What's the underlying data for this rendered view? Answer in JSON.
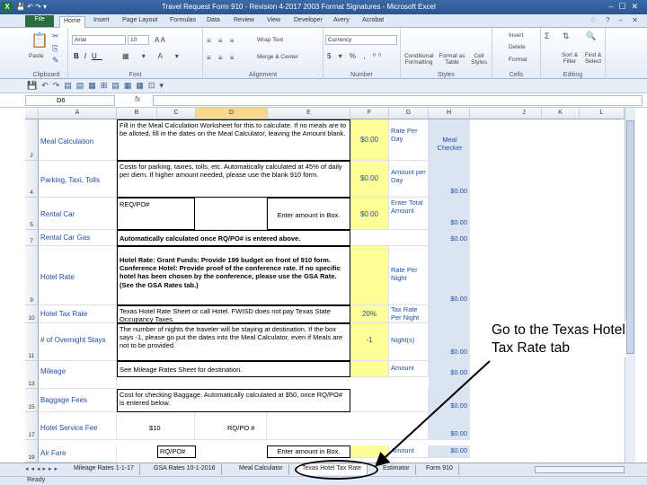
{
  "window": {
    "app_icon": "X",
    "title": "Travel Request Form 910 - Revision 4-2017 2003 Format Signatures - Microsoft Excel"
  },
  "ribbon_tabs": [
    "File",
    "Home",
    "Insert",
    "Page Layout",
    "Formulas",
    "Data",
    "Review",
    "View",
    "Developer",
    "Avery",
    "Acrobat"
  ],
  "ribbon": {
    "clipboard": {
      "paste": "Paste",
      "label": "Clipboard"
    },
    "font": {
      "name": "Arial",
      "size": "10",
      "label": "Font"
    },
    "alignment": {
      "wrap": "Wrap Text",
      "merge": "Merge & Center",
      "label": "Alignment"
    },
    "number": {
      "format": "Currency",
      "label": "Number"
    },
    "styles": {
      "conditional": "Conditional Formatting",
      "format_table": "Format as Table",
      "cell_styles": "Cell Styles",
      "label": "Styles"
    },
    "cells": {
      "insert": "Insert",
      "delete": "Delete",
      "format": "Format",
      "label": "Cells"
    },
    "editing": {
      "sort": "Sort & Filter",
      "find": "Find & Select",
      "label": "Editing"
    }
  },
  "formula_bar": {
    "name_box": "D6",
    "fx": "fx",
    "value": ""
  },
  "columns": [
    "A",
    "B",
    "C",
    "D",
    "E",
    "F",
    "G",
    "H",
    "I",
    "J",
    "K",
    "L"
  ],
  "sheet": {
    "rows": [
      {
        "row": "2",
        "label": "Meal Calculation",
        "instr": "Fill in the Meal Calculation Worksheet for this to calculate.  If no meals are to be alloted, fill in the dates on the Meal Calculator, leaving the Amount blank.",
        "amount": "$0.00",
        "g": "Rate Per Day",
        "h": "Meal Checker"
      },
      {
        "row": "4",
        "label": "Parking, Taxi, Tolls",
        "instr": "Costs for parking, taxies, tolls, etc.  Automatically calculated at 45% of daily per diem. If higher amount needed, please use the blank 910 form.",
        "amount": "$0.00",
        "g": "Amount per Day",
        "h": "$0.00"
      },
      {
        "row": "5",
        "label": "Rental Car",
        "b": "REQ/PO#",
        "e": "Enter amount in Box.",
        "amount": "$0.00",
        "g": "Enter Total Amount",
        "h": "$0.00"
      },
      {
        "row": "7",
        "label": "Rental Car Gas",
        "instr": "Automatically calculated  once RQ/PO# is entered above.",
        "h": "$0.00"
      },
      {
        "row": "9",
        "label": "Hotel Rate",
        "instr": "Hotel Rate: Grant Funds: Provide 199 budget on front of 910 form. Conference Hotel: Provide proof of the conference rate. If no specific hotel has been chosen by the conference, please use the GSA Rate. (See the GSA Rates tab.)",
        "g": "Rate Per Night",
        "h": "$0.00"
      },
      {
        "row": "10",
        "label": "Hotel Tax Rate",
        "instr": "Texas Hotel Rate Sheet or call Hotel.  FWISD does not pay Texas State Occupancy Taxes.",
        "amount": "20%",
        "g": "Tax Rate Per Night"
      },
      {
        "row": "11",
        "label": "# of Overnight Stays",
        "instr": "The number of nights the traveler will be staying at destination. If the box says -1, please go put the dates into the Meal Calculator, even if Meals are not to be provided.",
        "amount": "-1",
        "g": "Night(s)",
        "h": "$0.00"
      },
      {
        "row": "13",
        "label": "Mileage",
        "desc": "See Mileage Rates Sheet for destination.",
        "g": "Amount",
        "h": "$0.00"
      },
      {
        "row": "15",
        "label": "Baggage Fees",
        "instr": "Cost for checking Baggage. Automatically calculated at $50, once RQ/PO# is entered below.",
        "h": "$0.00"
      },
      {
        "row": "17",
        "label": "Hotel Service Fee",
        "b": "$10",
        "e": "RQ/PO #",
        "h": "$0.00"
      },
      {
        "row": "19",
        "label": "Air Fare",
        "b": "RQ/PO#",
        "e": "Enter amount in Box.",
        "g": "Amount",
        "h": "$0.00"
      }
    ]
  },
  "sheet_tabs": [
    "Mileage Rates 1-1-17",
    "GSA Rates 10-1-2016",
    "Meal Calculator",
    "Texas Hotel Tax Rate",
    "Estimator",
    "Form 910"
  ],
  "active_sheet_tab": "Texas Hotel Tax Rate",
  "status": {
    "text": "Ready"
  },
  "annotation": {
    "text": "Go to the Texas Hotel Tax Rate tab"
  }
}
